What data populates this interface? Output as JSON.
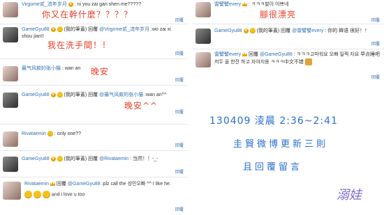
{
  "left": [
    {
      "user": "Virgome贰_流年岁月",
      "text": ": ni you zai gan shen me?????",
      "annotation": "你又在幹什麼？？？？",
      "reply": "回覆"
    },
    {
      "user": "GameGyu88",
      "prefix": "(我的筆蓋)",
      "forward_label": "回覆",
      "forward_user": "@Virgome贰_流年岁月",
      "text": ":wo zai xi shou jian!!",
      "annotation": "我在洗手間！！",
      "reply": "回覆"
    },
    {
      "user": "最气风款的张小猫",
      "text": ": wan an",
      "annotation": "晚安",
      "reply": "回覆"
    },
    {
      "user": "GameGyu88",
      "prefix": "(我的筆蓋)",
      "forward_label": "回覆",
      "forward_user": "@最气风款的张小猫",
      "text": ":wan an^^",
      "annotation": "晚安^^",
      "reply": "回覆"
    },
    {
      "user": "Rivataemin",
      "text": ": only one??",
      "reply": "回覆"
    },
    {
      "user": "GameGyu88",
      "prefix": "(我的筆蓋)",
      "forward_label": "回覆",
      "forward_user": "@Rivataemin",
      "text": ": 当然！！-_-",
      "reply": "回覆"
    },
    {
      "user": "Rivataemin",
      "forward_label": "回覆",
      "forward_user": "@GameGyu88",
      "text": ":plz call the 성민오빠 ^^ I like he.",
      "text2": "and i love u too",
      "reply": "回覆"
    }
  ],
  "right": [
    {
      "user": "雷譬譬every",
      "text": ": ㅋㅋㅋ발이 이쁘네",
      "annotation": "腳很漂亮",
      "reply": "回覆"
    },
    {
      "user": "GameGyu88",
      "prefix": "(我的筆蓋)",
      "forward_label": "回覆",
      "forward_user": "@雷譬譬every",
      "text": ": 你的 韓语 很好！！",
      "reply": "回覆"
    },
    {
      "user": "雷譬譬every",
      "forward_label": "回覆",
      "forward_user": "@GameGyu88",
      "text": ": ㅋㅋㅋ고마워요 오빠 일찍 자요",
      "text2": "早点睡吧저두 을 한잔 하고 자야지용 ㅋㅋㅋ中文不错",
      "reply": "回覆"
    }
  ],
  "caption": {
    "line1": "130409 淩晨 2:36~2:41",
    "line2": "圭賢微博更新三則",
    "line3": "且回覆留言",
    "signature": "溺娃"
  }
}
